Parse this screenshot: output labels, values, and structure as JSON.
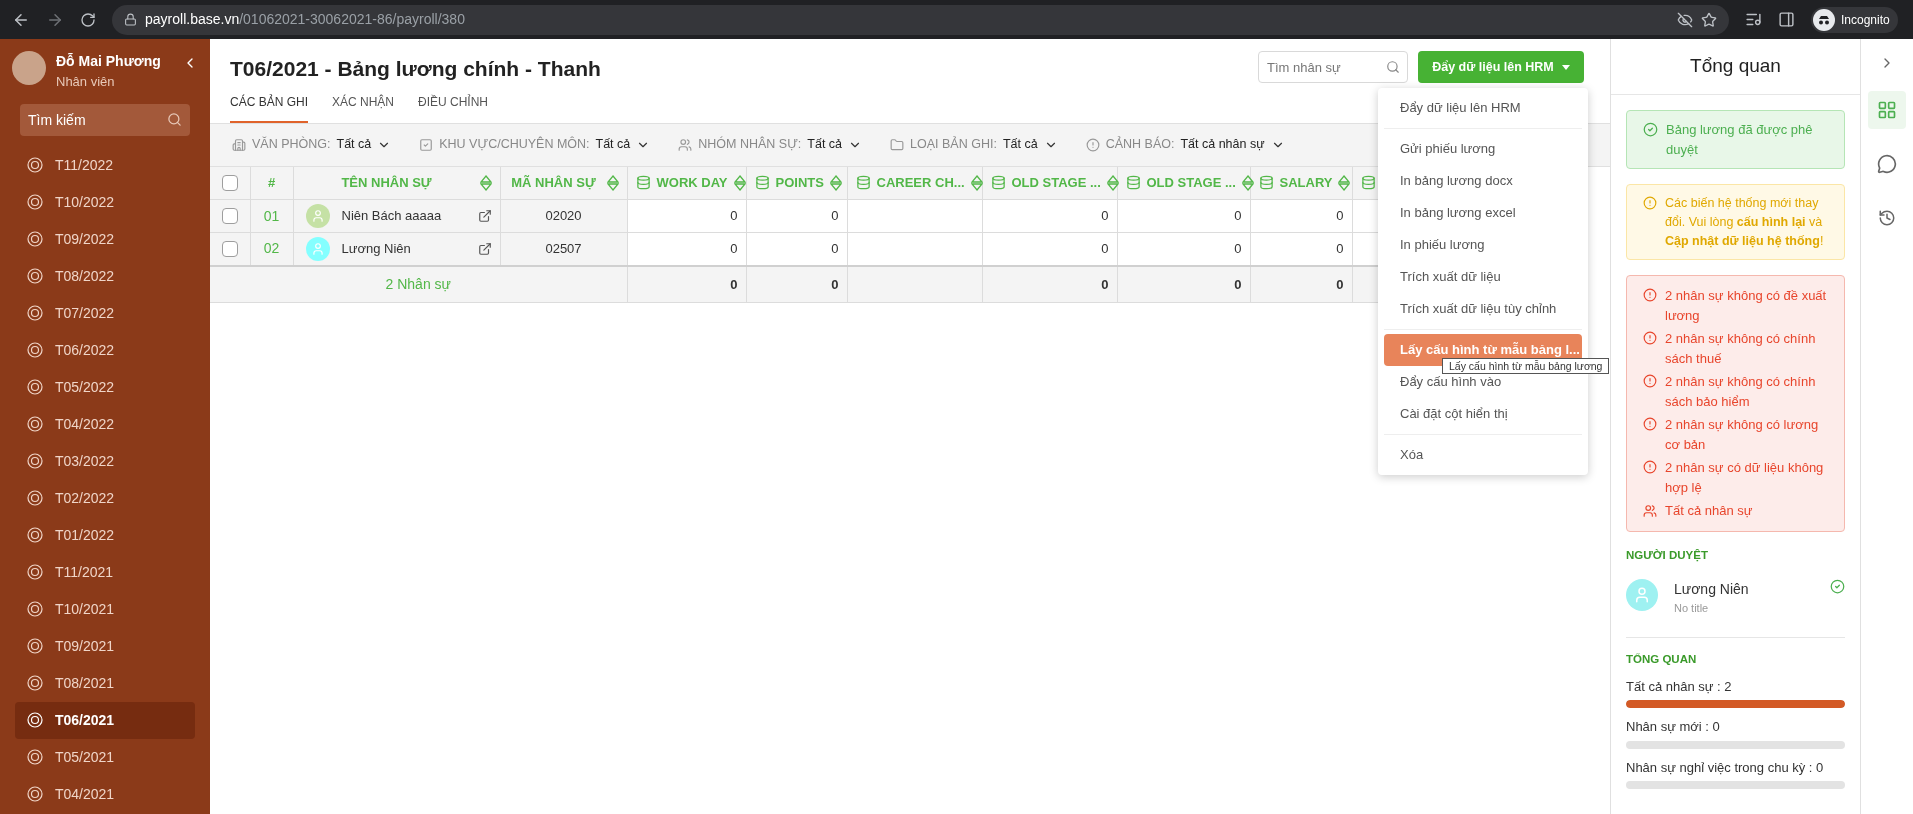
{
  "browser": {
    "url_host": "payroll.base.vn",
    "url_path": "/01062021-30062021-86/payroll/380",
    "profile_label": "Incognito"
  },
  "sidebar": {
    "user": {
      "name": "Đỗ Mai Phương",
      "role": "Nhân viên"
    },
    "search": {
      "placeholder": "Tìm kiếm"
    },
    "items": [
      {
        "label": "T11/2022",
        "selected": false
      },
      {
        "label": "T10/2022",
        "selected": false
      },
      {
        "label": "T09/2022",
        "selected": false
      },
      {
        "label": "T08/2022",
        "selected": false
      },
      {
        "label": "T07/2022",
        "selected": false
      },
      {
        "label": "T06/2022",
        "selected": false
      },
      {
        "label": "T05/2022",
        "selected": false
      },
      {
        "label": "T04/2022",
        "selected": false
      },
      {
        "label": "T03/2022",
        "selected": false
      },
      {
        "label": "T02/2022",
        "selected": false
      },
      {
        "label": "T01/2022",
        "selected": false
      },
      {
        "label": "T11/2021",
        "selected": false
      },
      {
        "label": "T10/2021",
        "selected": false
      },
      {
        "label": "T09/2021",
        "selected": false
      },
      {
        "label": "T08/2021",
        "selected": false
      },
      {
        "label": "T06/2021",
        "selected": true
      },
      {
        "label": "T05/2021",
        "selected": false
      },
      {
        "label": "T04/2021",
        "selected": false
      }
    ]
  },
  "header": {
    "title": "T06/2021 - Bảng lương chính - Thanh",
    "search": {
      "placeholder": "Tìm nhân sự"
    },
    "action_button": "Đẩy dữ liệu lên HRM",
    "tabs": [
      {
        "label": "CÁC BẢN GHI",
        "selected": true
      },
      {
        "label": "XÁC NHẬN",
        "selected": false
      },
      {
        "label": "ĐIỀU CHỈNH",
        "selected": false
      }
    ]
  },
  "filters": [
    {
      "label": "VĂN PHÒNG:",
      "value": "Tất cả"
    },
    {
      "label": "KHU VỰC/CHUYÊN MÔN:",
      "value": "Tất cả"
    },
    {
      "label": "NHÓM NHÂN SỰ:",
      "value": "Tất cả"
    },
    {
      "label": "LOẠI BẢN GHI:",
      "value": "Tất cả"
    },
    {
      "label": "CẢNH BÁO:",
      "value": "Tất cả nhân sự"
    }
  ],
  "table": {
    "columns": [
      {
        "kind": "check",
        "checked": false
      },
      {
        "kind": "plain",
        "label": "#"
      },
      {
        "kind": "plain",
        "label": "TÊN NHÂN SỰ",
        "sortable": true
      },
      {
        "kind": "plain",
        "label": "MÃ NHÂN SỰ",
        "sortable": true
      },
      {
        "kind": "data",
        "label": "WORK DAY",
        "sortable": true
      },
      {
        "kind": "data",
        "label": "POINTS",
        "sortable": true
      },
      {
        "kind": "data",
        "label": "CAREER CH...",
        "sortable": true
      },
      {
        "kind": "data",
        "label": "OLD STAGE ...",
        "sortable": true
      },
      {
        "kind": "data",
        "label": "OLD STAGE ...",
        "sortable": true
      },
      {
        "kind": "data",
        "label": "SALARY",
        "sortable": true
      },
      {
        "kind": "data"
      }
    ],
    "rows": [
      {
        "cells": [
          {
            "kind": "check",
            "checked": false
          },
          {
            "kind": "index",
            "text": "01"
          },
          {
            "kind": "employee",
            "name": "Niên Bách aaaaa",
            "color": "#c5e1a5"
          },
          {
            "kind": "code",
            "text": "02020"
          },
          {
            "kind": "number",
            "text": "0"
          },
          {
            "kind": "number",
            "text": "0"
          },
          {
            "kind": "empty"
          },
          {
            "kind": "number",
            "text": "0"
          },
          {
            "kind": "number",
            "text": "0"
          },
          {
            "kind": "number",
            "text": "0"
          },
          {
            "kind": "empty"
          }
        ]
      },
      {
        "cells": [
          {
            "kind": "check",
            "checked": false
          },
          {
            "kind": "index",
            "text": "02"
          },
          {
            "kind": "employee",
            "name": "Lương Niên",
            "color": "#84ffff"
          },
          {
            "kind": "code",
            "text": "02507"
          },
          {
            "kind": "number",
            "text": "0"
          },
          {
            "kind": "number",
            "text": "0"
          },
          {
            "kind": "empty"
          },
          {
            "kind": "number",
            "text": "0"
          },
          {
            "kind": "number",
            "text": "0"
          },
          {
            "kind": "number",
            "text": "0"
          },
          {
            "kind": "empty"
          }
        ]
      }
    ],
    "total": {
      "cells": [
        {
          "kind": "label",
          "text": "2 Nhân sự"
        },
        {
          "kind": "number",
          "text": "0"
        },
        {
          "kind": "number",
          "text": "0"
        },
        {
          "kind": "empty"
        },
        {
          "kind": "number",
          "text": "0"
        },
        {
          "kind": "number",
          "text": "0"
        },
        {
          "kind": "number",
          "text": "0"
        },
        {
          "kind": "empty"
        }
      ]
    }
  },
  "menu": {
    "groups": [
      [
        {
          "label": "Đẩy dữ liệu lên HRM",
          "selected": false
        }
      ],
      [
        {
          "label": "Gửi phiếu lương",
          "selected": false
        },
        {
          "label": "In bảng lương docx",
          "selected": false
        },
        {
          "label": "In bảng lương excel",
          "selected": false
        },
        {
          "label": "In phiếu lương",
          "selected": false
        },
        {
          "label": "Trích xuất dữ liệu",
          "selected": false
        },
        {
          "label": "Trích xuất dữ liệu tùy chỉnh",
          "selected": false
        }
      ],
      [
        {
          "label": "Lấy cấu hình từ mẫu bảng l...",
          "selected": true
        },
        {
          "label": "Đẩy cấu hình vào",
          "selected": false
        },
        {
          "label": "Cài đặt cột hiển thị",
          "selected": false
        }
      ],
      [
        {
          "label": "Xóa",
          "selected": false
        }
      ]
    ],
    "tooltip": "Lấy cấu hình từ mẫu bảng lương"
  },
  "overview_panel": {
    "title": "Tổng quan",
    "success": "Bảng lương đã được phê duyệt",
    "warning": "Các biến hệ thống mới thay đổi. Vui lòng **cấu hình lại** và **Cập nhật dữ liệu hệ thống**!",
    "errors": [
      "2 nhân sự không có đề xuất lương",
      "2 nhân sự không có chính sách thuế",
      "2 nhân sự không có chính sách bảo hiểm",
      "2 nhân sự không có lương cơ bản",
      "2 nhân sự có dữ liệu không hợp lệ"
    ],
    "all_staff_link": "Tất cả nhân sự",
    "approvers_title": "NGƯỜI DUYỆT",
    "approver": {
      "name": "Lương Niên",
      "subtitle": "No title",
      "approved": true
    },
    "stats_title": "TỔNG QUAN",
    "stats": [
      {
        "label": "Tất cả nhân sự : 2",
        "level": 1
      },
      {
        "label": "Nhân sự mới : 0",
        "level": 0
      },
      {
        "label": "Nhân sự nghỉ việc trong chu kỳ : 0",
        "level": 0
      }
    ]
  },
  "side_strip": [
    {
      "kind": "grid",
      "selected": true
    },
    {
      "kind": "info",
      "selected": false
    },
    {
      "kind": "history",
      "selected": false
    }
  ]
}
